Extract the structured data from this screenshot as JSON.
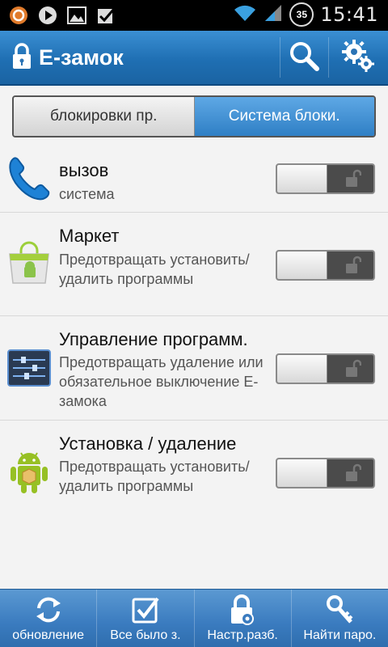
{
  "status_bar": {
    "time": "15:41",
    "battery_level": "35",
    "icons": [
      "notification-app-icon",
      "play-icon",
      "image-icon",
      "checkbox-icon",
      "wifi-icon",
      "signal-icon"
    ]
  },
  "action_bar": {
    "title": "E-замок",
    "color": "#2277bb"
  },
  "tabs": [
    {
      "label": "блокировки пр.",
      "active": false
    },
    {
      "label": "Система блоки.",
      "active": true
    }
  ],
  "items": [
    {
      "title": "вызов",
      "description": "система",
      "icon": "phone-icon",
      "enabled": false
    },
    {
      "title": "Маркет",
      "description": "Предотвращать установить/удалить программы",
      "icon": "market-icon",
      "enabled": false
    },
    {
      "title": "Управление программ.",
      "description": "Предотвращать удаление или обязательное выключение E-замока",
      "icon": "app-settings-icon",
      "enabled": false
    },
    {
      "title": "Установка / удаление",
      "description": "Предотвращать установить/удалить программы",
      "icon": "android-icon",
      "enabled": false
    }
  ],
  "bottom_bar": [
    {
      "label": "обновление",
      "icon": "refresh-icon"
    },
    {
      "label": "Все было з.",
      "icon": "check-icon"
    },
    {
      "label": "Настр.разб.",
      "icon": "lock-settings-icon"
    },
    {
      "label": "Найти паро.",
      "icon": "key-icon"
    }
  ]
}
